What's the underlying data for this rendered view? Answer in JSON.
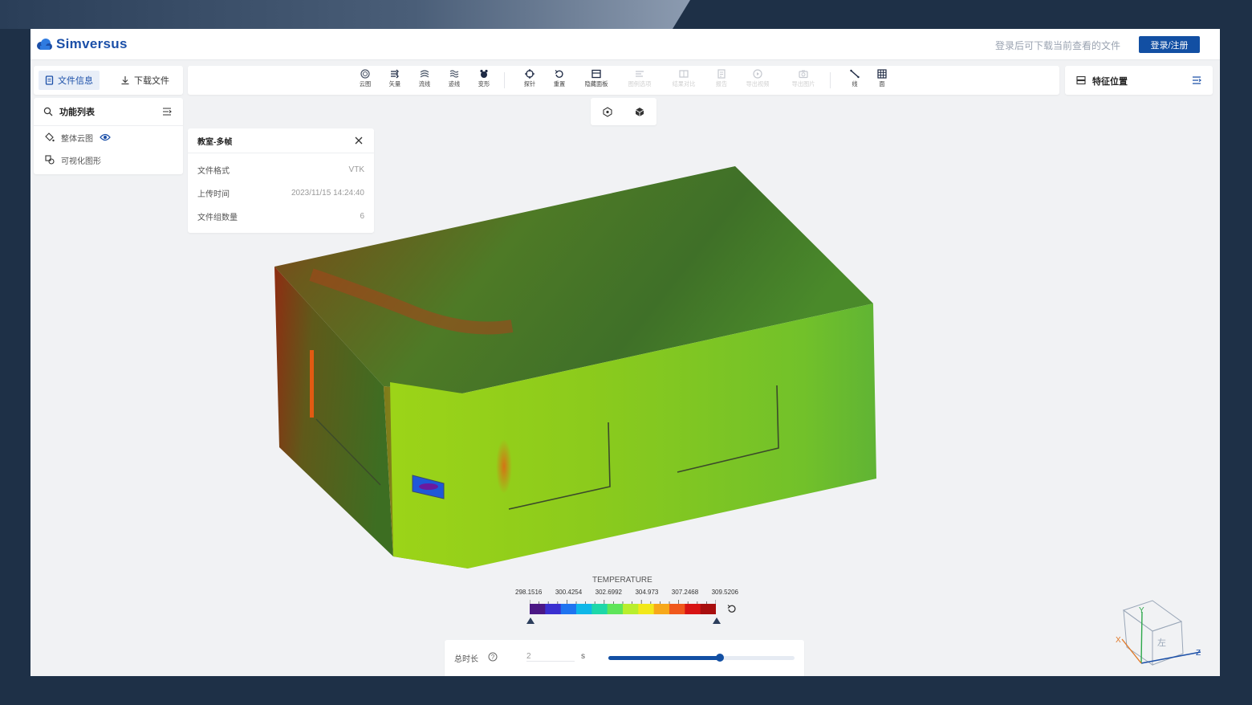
{
  "app": {
    "brand": "Simversus",
    "hint": "登录后可下载当前查看的文件",
    "login_button": "登录/注册",
    "accent": "#124fa3"
  },
  "left_tabs": [
    {
      "label": "文件信息",
      "icon": "file-info-icon",
      "active": true
    },
    {
      "label": "下载文件",
      "icon": "download-icon",
      "active": false
    }
  ],
  "toolbar": [
    {
      "label": "云图",
      "icon": "contour-icon",
      "enabled": true
    },
    {
      "label": "矢量",
      "icon": "vector-icon",
      "enabled": true
    },
    {
      "label": "流线",
      "icon": "streamline-icon",
      "enabled": true
    },
    {
      "label": "迹线",
      "icon": "pathline-icon",
      "enabled": true
    },
    {
      "label": "变形",
      "icon": "deform-icon",
      "enabled": true
    },
    {
      "label": "探针",
      "icon": "probe-icon",
      "enabled": true
    },
    {
      "label": "重置",
      "icon": "reset-icon",
      "enabled": true
    },
    {
      "label": "隐藏面板",
      "icon": "hide-panel-icon",
      "enabled": true
    },
    {
      "label": "图例选项",
      "icon": "legend-options-icon",
      "enabled": false
    },
    {
      "label": "结果对比",
      "icon": "compare-icon",
      "enabled": false
    },
    {
      "label": "报告",
      "icon": "report-icon",
      "enabled": false
    },
    {
      "label": "导出视频",
      "icon": "export-video-icon",
      "enabled": false
    },
    {
      "label": "导出图片",
      "icon": "export-image-icon",
      "enabled": false
    },
    {
      "label": "线",
      "icon": "line-icon",
      "enabled": true
    },
    {
      "label": "面",
      "icon": "surface-icon",
      "enabled": true
    }
  ],
  "feature_panel": {
    "label": "特征位置"
  },
  "function_list": {
    "title": "功能列表",
    "items": [
      {
        "label": "整体云图",
        "icon": "paint-bucket-icon",
        "visible": true
      },
      {
        "label": "可视化图形",
        "icon": "shapes-icon",
        "visible": false
      }
    ]
  },
  "file_info": {
    "title": "教室-多帧",
    "rows": [
      {
        "key": "文件格式",
        "value": "VTK"
      },
      {
        "key": "上传时间",
        "value": "2023/11/15 14:24:40"
      },
      {
        "key": "文件组数量",
        "value": "6"
      }
    ]
  },
  "legend": {
    "title": "TEMPERATURE",
    "ticks": [
      "298.1516",
      "300.4254",
      "302.6992",
      "304.973",
      "307.2468",
      "309.5206"
    ],
    "colors": [
      "#4b1785",
      "#3a2fd0",
      "#1f74f0",
      "#0fb7e8",
      "#1ed7a9",
      "#5fe55a",
      "#b9ee2d",
      "#f2e81a",
      "#f7a81a",
      "#f0581c",
      "#d81414",
      "#a80e0e"
    ]
  },
  "timeline": {
    "label": "总时长",
    "value": "2",
    "unit": "s",
    "progress": 0.6
  },
  "axes": {
    "x": "X",
    "y": "Y",
    "z": "Z",
    "face": "左"
  }
}
